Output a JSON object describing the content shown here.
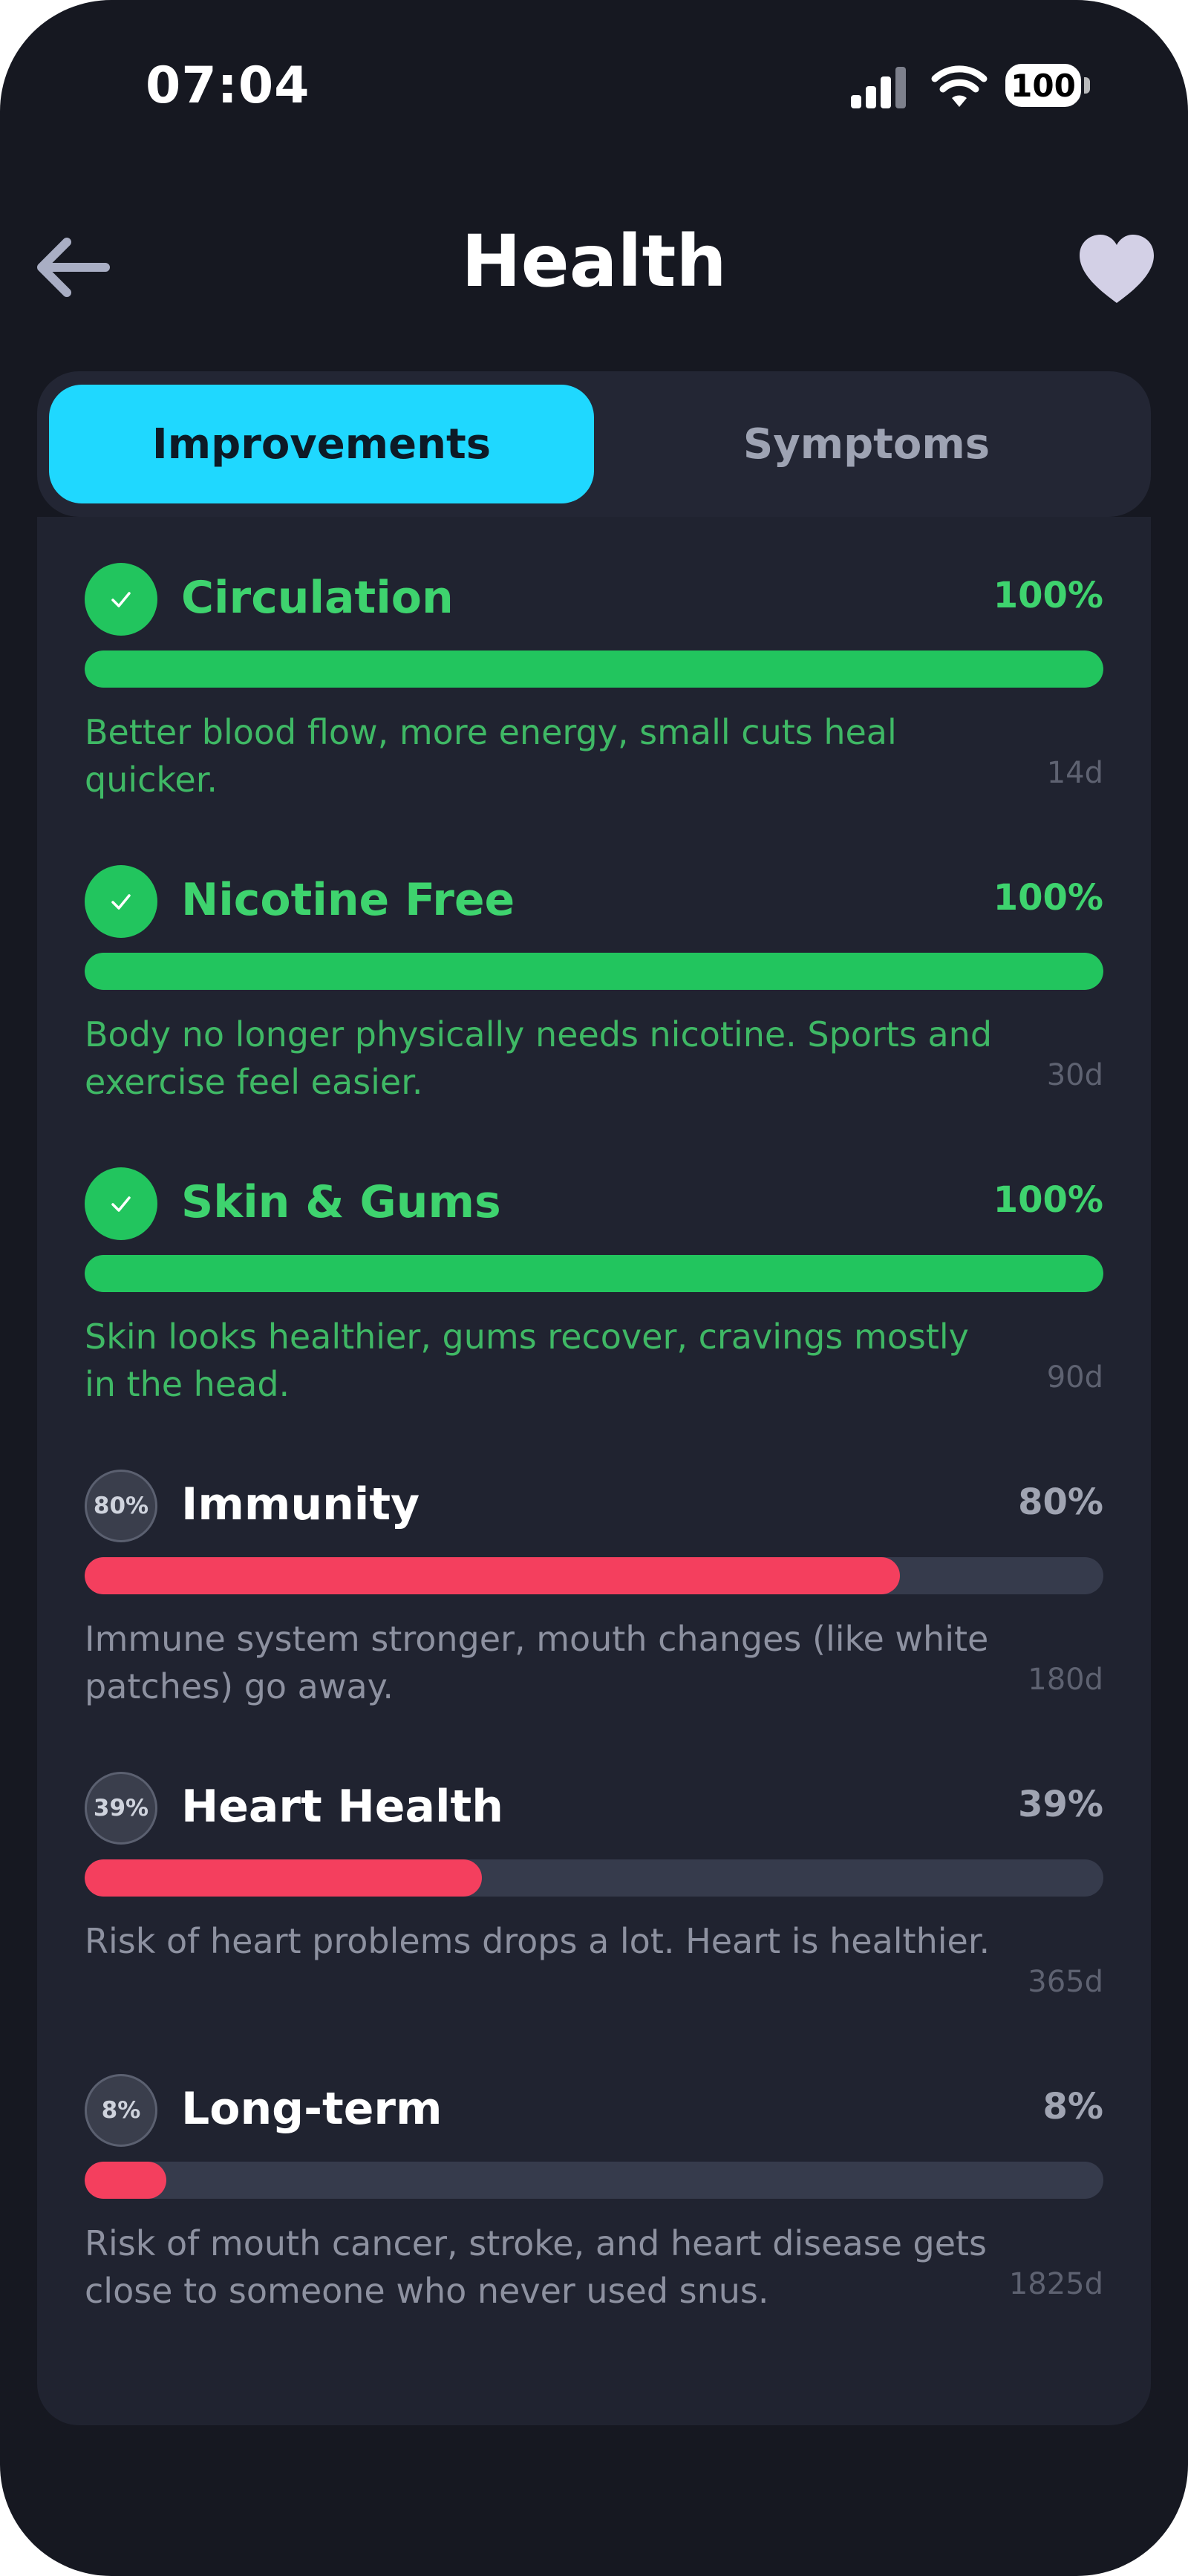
{
  "status_bar": {
    "time": "07:04",
    "battery": "100"
  },
  "header": {
    "title": "Health"
  },
  "tabs": [
    {
      "label": "Improvements",
      "active": true
    },
    {
      "label": "Symptoms",
      "active": false
    }
  ],
  "colors": {
    "accent": "#1fd8ff",
    "complete": "#22c55e",
    "in_progress": "#f43f5e",
    "background": "#161821"
  },
  "items": [
    {
      "title": "Circulation",
      "percent_label": "100%",
      "progress": 1.0,
      "status": "done",
      "description": "Better blood flow, more energy, small cuts heal quicker.",
      "days": "14d"
    },
    {
      "title": "Nicotine Free",
      "percent_label": "100%",
      "progress": 1.0,
      "status": "done",
      "description": "Body no longer physically needs nicotine. Sports and exercise feel easier.",
      "days": "30d"
    },
    {
      "title": "Skin & Gums",
      "percent_label": "100%",
      "progress": 1.0,
      "status": "done",
      "description": "Skin looks healthier, gums recover, cravings mostly in the head.",
      "days": "90d"
    },
    {
      "title": "Immunity",
      "percent_label": "80%",
      "progress": 0.8,
      "status": "pending",
      "badge": "80%",
      "description": "Immune system stronger, mouth changes (like white patches) go away.",
      "days": "180d"
    },
    {
      "title": "Heart Health",
      "percent_label": "39%",
      "progress": 0.39,
      "status": "pending",
      "badge": "39%",
      "description": "Risk of heart problems drops a lot. Heart is healthier.",
      "days": "365d"
    },
    {
      "title": "Long-term",
      "percent_label": "8%",
      "progress": 0.08,
      "status": "pending",
      "badge": "8%",
      "description": "Risk of mouth cancer, stroke, and heart disease gets close to someone who never used snus.",
      "days": "1825d"
    }
  ]
}
